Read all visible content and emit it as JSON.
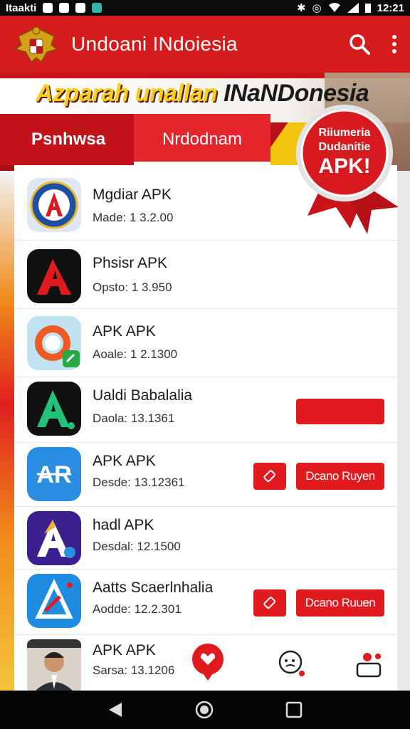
{
  "status_bar": {
    "carrier": "Itaakti",
    "time": "12:21"
  },
  "app_bar": {
    "title": "Undoani INdoiesia",
    "search_icon": "search-icon",
    "more_icon": "more-vert-icon"
  },
  "banner": {
    "headline_part1": "Azparah unallan ",
    "headline_part2": "INaNDonesia",
    "tabs": [
      "Psnhwsa",
      "Nrdodnam"
    ],
    "badge_line1": "Riiumeria",
    "badge_line2": "Dudanitie",
    "badge_line3": "APK!"
  },
  "apps": [
    {
      "name": "Mgdiar APK",
      "sub": "Made: 1 3.2.00",
      "icon": "emblem-a-icon"
    },
    {
      "name": "Phsisr APK",
      "sub": "Opsto: 1 3.950",
      "icon": "red-a-icon"
    },
    {
      "name": "APK APK",
      "sub": "Aoale: 1 2.1300",
      "icon": "refresh-arrow-icon"
    },
    {
      "name": "Ualdi Babalalia",
      "sub": "Daola: 13.1361",
      "icon": "green-a-icon"
    },
    {
      "name": "APK APK",
      "sub": "Desde: 13.12361",
      "icon": "ar-icon",
      "button_label": "Dcano Ruyen"
    },
    {
      "name": "hadl APK",
      "sub": "Desdal: 12.1500",
      "icon": "purple-a-icon"
    },
    {
      "name": "Aatts Scaerlnhalia",
      "sub": "Aodde: 12.2.301",
      "icon": "blue-a-icon",
      "button_label": "Dcano Ruuen"
    },
    {
      "name": "APK APK",
      "sub": "Sarsa: 13.1206",
      "icon": "person-photo-icon"
    }
  ],
  "colors": {
    "primary": "#d41c1c",
    "accent": "#f5cf1a",
    "button": "#e01a1f"
  }
}
